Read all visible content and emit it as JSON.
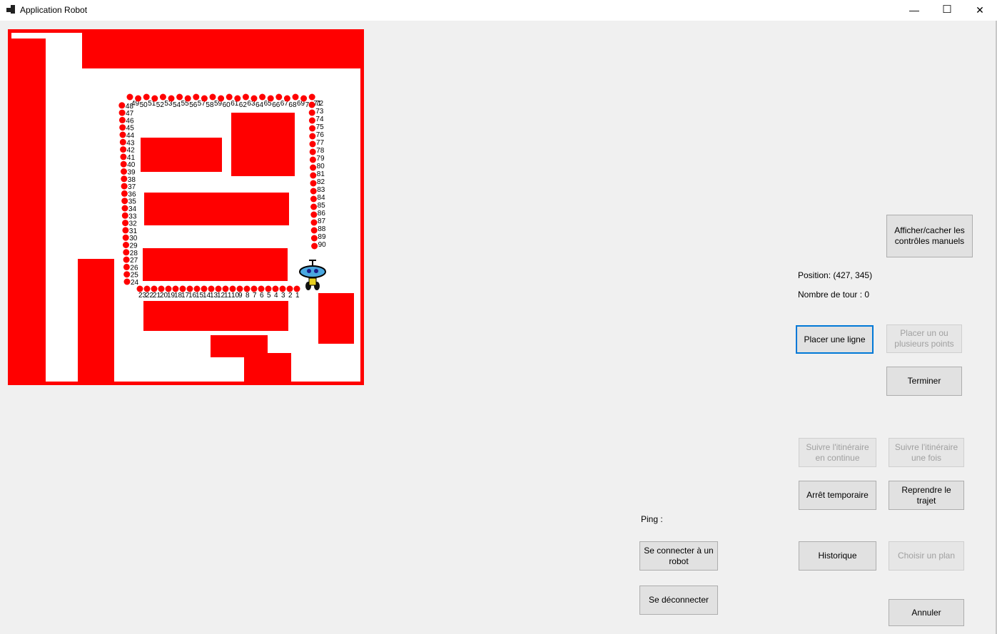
{
  "window": {
    "title": "Application Robot",
    "minimize": "—",
    "maximize": "☐",
    "close": "✕"
  },
  "colors": {
    "obstacle": "#ff0000",
    "waypoint": "#ff0000",
    "robot_body": "#4aa8e0",
    "focus_border": "#0078d7"
  },
  "map": {
    "waypoint_labels": [
      "1",
      "2",
      "3",
      "4",
      "5",
      "6",
      "7",
      "8",
      "9",
      "10",
      "11",
      "12",
      "13",
      "14",
      "15",
      "16",
      "17",
      "18",
      "19",
      "20",
      "21",
      "22",
      "23",
      "24",
      "25",
      "26",
      "27",
      "28",
      "29",
      "30",
      "31",
      "32",
      "33",
      "34",
      "35",
      "36",
      "37",
      "38",
      "39",
      "40",
      "41",
      "42",
      "43",
      "44",
      "45",
      "46",
      "47",
      "48",
      "49",
      "50",
      "51",
      "52",
      "53",
      "54",
      "55",
      "56",
      "57",
      "58",
      "59",
      "60",
      "61",
      "62",
      "63",
      "64",
      "65",
      "66",
      "67",
      "68",
      "69",
      "70",
      "71",
      "72",
      "73",
      "74",
      "75",
      "76",
      "77",
      "78",
      "79",
      "80",
      "81",
      "82",
      "83",
      "84",
      "85",
      "86",
      "87",
      "88",
      "89",
      "90"
    ],
    "robot_icon": "robot-icon"
  },
  "controls": {
    "toggle_manual": "Afficher/cacher les contrôles manuels",
    "position": "Position: (427, 345)",
    "laps": "Nombre de tour : 0",
    "place_line": "Placer une ligne",
    "place_points": "Placer un ou plusieurs points",
    "finish": "Terminer",
    "follow_continuous": "Suivre l'itinéraire en continue",
    "follow_once": "Suivre l'itinéraire une fois",
    "pause": "Arrêt temporaire",
    "resume": "Reprendre le trajet",
    "history": "Historique",
    "choose_plan": "Choisir un plan",
    "cancel": "Annuler",
    "ping": "Ping :",
    "connect": "Se connecter à un robot",
    "disconnect": "Se déconnecter"
  }
}
